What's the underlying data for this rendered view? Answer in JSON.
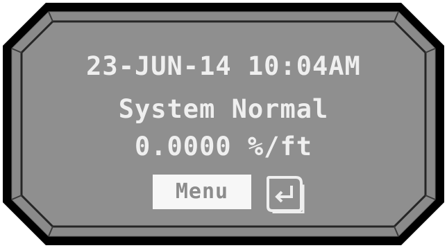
{
  "display": {
    "datetime": "23-JUN-14 10:04AM",
    "status": "System Normal",
    "reading": "0.0000 %/ft"
  },
  "controls": {
    "menu_label": "Menu",
    "enter_icon": "enter-return-icon"
  },
  "colors": {
    "screen_background": "#8f8f8f",
    "bezel_outer": "#000000",
    "bezel_inner": "#8a8a8a",
    "lcd_text": "#efefef",
    "menu_button_background": "#f7f7f7",
    "menu_button_text": "#8c8c8c"
  }
}
